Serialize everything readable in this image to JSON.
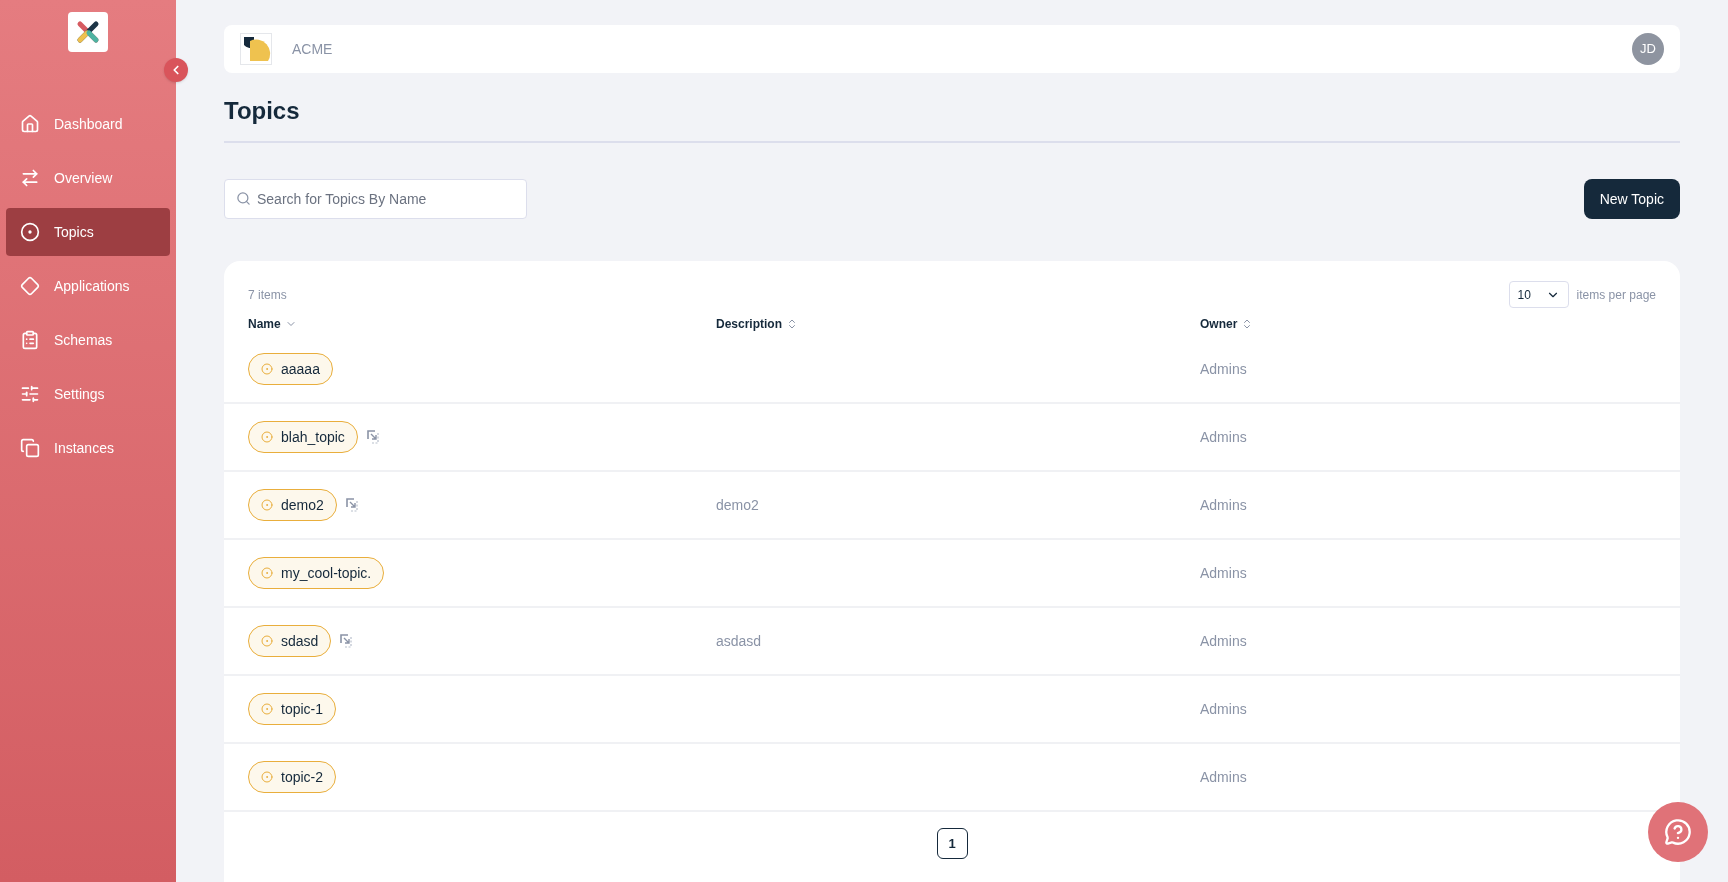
{
  "sidebar": {
    "items": [
      {
        "label": "Dashboard",
        "selected": false
      },
      {
        "label": "Overview",
        "selected": false
      },
      {
        "label": "Topics",
        "selected": true
      },
      {
        "label": "Applications",
        "selected": false
      },
      {
        "label": "Schemas",
        "selected": false
      },
      {
        "label": "Settings",
        "selected": false
      },
      {
        "label": "Instances",
        "selected": false
      }
    ]
  },
  "header": {
    "org": "ACME",
    "avatar": "JD"
  },
  "page": {
    "title": "Topics"
  },
  "search": {
    "placeholder": "Search for Topics By Name"
  },
  "new_button": "New Topic",
  "table": {
    "count": "7 items",
    "page_size": "10",
    "page_size_label": "items per page",
    "columns": [
      {
        "label": "Name",
        "sorted": true
      },
      {
        "label": "Description",
        "sorted": false
      },
      {
        "label": "Owner",
        "sorted": false
      }
    ],
    "rows": [
      {
        "name": "aaaaa",
        "shared": false,
        "description": "",
        "owner": "Admins"
      },
      {
        "name": "blah_topic",
        "shared": true,
        "description": "",
        "owner": "Admins"
      },
      {
        "name": "demo2",
        "shared": true,
        "description": "demo2",
        "owner": "Admins"
      },
      {
        "name": "my_cool-topic.",
        "shared": false,
        "description": "",
        "owner": "Admins"
      },
      {
        "name": "sdasd",
        "shared": true,
        "description": "asdasd",
        "owner": "Admins"
      },
      {
        "name": "topic-1",
        "shared": false,
        "description": "",
        "owner": "Admins"
      },
      {
        "name": "topic-2",
        "shared": false,
        "description": "",
        "owner": "Admins"
      }
    ]
  },
  "pagination": {
    "pages": [
      {
        "label": "1",
        "selected": true
      }
    ]
  }
}
